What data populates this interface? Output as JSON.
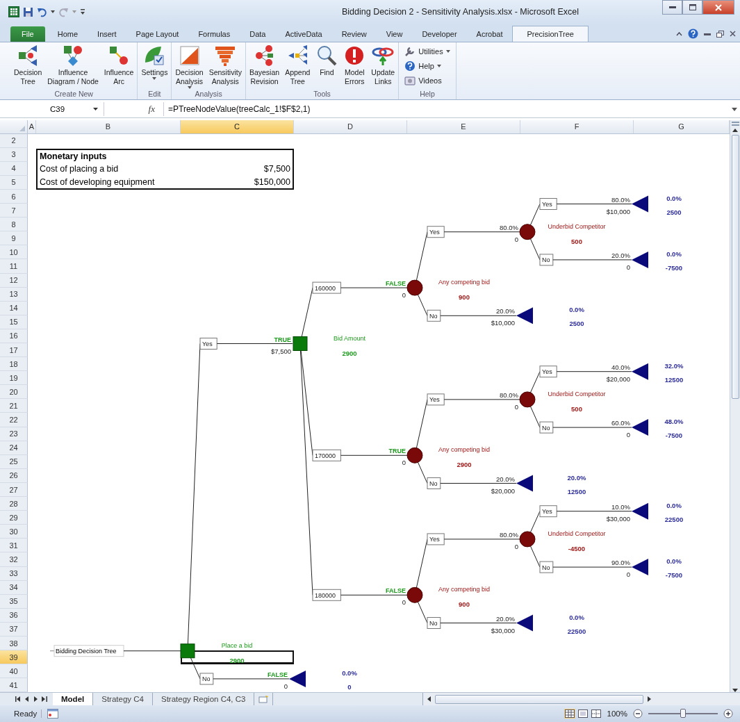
{
  "window": {
    "title": "Bidding Decision 2 - Sensitivity Analysis.xlsx - Microsoft Excel"
  },
  "ribbon_tabs": [
    {
      "label": "File",
      "kind": "file",
      "selected": false
    },
    {
      "label": "Home",
      "kind": "tab",
      "selected": false
    },
    {
      "label": "Insert",
      "kind": "tab",
      "selected": false
    },
    {
      "label": "Page Layout",
      "kind": "tab",
      "selected": false
    },
    {
      "label": "Formulas",
      "kind": "tab",
      "selected": false
    },
    {
      "label": "Data",
      "kind": "tab",
      "selected": false
    },
    {
      "label": "ActiveData",
      "kind": "tab",
      "selected": false
    },
    {
      "label": "Review",
      "kind": "tab",
      "selected": false
    },
    {
      "label": "View",
      "kind": "tab",
      "selected": false
    },
    {
      "label": "Developer",
      "kind": "tab",
      "selected": false
    },
    {
      "label": "Acrobat",
      "kind": "tab",
      "selected": false
    },
    {
      "label": "PrecisionTree",
      "kind": "tab",
      "selected": true
    }
  ],
  "ribbon_groups": [
    {
      "label": "Create New",
      "buttons": [
        {
          "label": "Decision\nTree",
          "kind": "large",
          "has_menu": false
        },
        {
          "label": "Influence\nDiagram / Node",
          "kind": "large",
          "has_menu": false
        },
        {
          "label": "Influence\nArc",
          "kind": "large",
          "has_menu": false
        }
      ]
    },
    {
      "label": "Edit",
      "buttons": [
        {
          "label": "Settings",
          "kind": "large",
          "has_menu": true
        }
      ]
    },
    {
      "label": "Analysis",
      "buttons": [
        {
          "label": "Decision\nAnalysis",
          "kind": "large",
          "has_menu": true
        },
        {
          "label": "Sensitivity\nAnalysis",
          "kind": "large",
          "has_menu": false
        }
      ]
    },
    {
      "label": "Tools",
      "buttons": [
        {
          "label": "Bayesian\nRevision",
          "kind": "large",
          "has_menu": false
        },
        {
          "label": "Append\nTree",
          "kind": "large",
          "has_menu": false
        },
        {
          "label": "Find",
          "kind": "large",
          "has_menu": false
        },
        {
          "label": "Model\nErrors",
          "kind": "large",
          "has_menu": false
        },
        {
          "label": "Update\nLinks",
          "kind": "large",
          "has_menu": false
        }
      ]
    },
    {
      "label": "Help",
      "buttons": [
        {
          "label": "Utilities",
          "kind": "small",
          "has_menu": true
        },
        {
          "label": "Help",
          "kind": "small",
          "has_menu": true
        },
        {
          "label": "Videos",
          "kind": "small",
          "has_menu": false
        }
      ]
    }
  ],
  "formula_bar": {
    "name_box": "C39",
    "function_label": "fx",
    "formula": "=PTreeNodeValue(treeCalc_1!$F$2,1)"
  },
  "columns": [
    {
      "label": "A",
      "selected": false
    },
    {
      "label": "B",
      "selected": false
    },
    {
      "label": "C",
      "selected": true
    },
    {
      "label": "D",
      "selected": false
    },
    {
      "label": "E",
      "selected": false
    },
    {
      "label": "F",
      "selected": false
    },
    {
      "label": "G",
      "selected": false
    }
  ],
  "rows": [
    {
      "label": "2",
      "selected": false
    },
    {
      "label": "3",
      "selected": false
    },
    {
      "label": "4",
      "selected": false
    },
    {
      "label": "5",
      "selected": false
    },
    {
      "label": "6",
      "selected": false
    },
    {
      "label": "7",
      "selected": false
    },
    {
      "label": "8",
      "selected": false
    },
    {
      "label": "9",
      "selected": false
    },
    {
      "label": "10",
      "selected": false
    },
    {
      "label": "11",
      "selected": false
    },
    {
      "label": "12",
      "selected": false
    },
    {
      "label": "13",
      "selected": false
    },
    {
      "label": "14",
      "selected": false
    },
    {
      "label": "15",
      "selected": false
    },
    {
      "label": "16",
      "selected": false
    },
    {
      "label": "17",
      "selected": false
    },
    {
      "label": "18",
      "selected": false
    },
    {
      "label": "19",
      "selected": false
    },
    {
      "label": "20",
      "selected": false
    },
    {
      "label": "21",
      "selected": false
    },
    {
      "label": "22",
      "selected": false
    },
    {
      "label": "23",
      "selected": false
    },
    {
      "label": "24",
      "selected": false
    },
    {
      "label": "25",
      "selected": false
    },
    {
      "label": "26",
      "selected": false
    },
    {
      "label": "27",
      "selected": false
    },
    {
      "label": "28",
      "selected": false
    },
    {
      "label": "29",
      "selected": false
    },
    {
      "label": "30",
      "selected": false
    },
    {
      "label": "31",
      "selected": false
    },
    {
      "label": "32",
      "selected": false
    },
    {
      "label": "33",
      "selected": false
    },
    {
      "label": "34",
      "selected": false
    },
    {
      "label": "35",
      "selected": false
    },
    {
      "label": "36",
      "selected": false
    },
    {
      "label": "37",
      "selected": false
    },
    {
      "label": "38",
      "selected": false
    },
    {
      "label": "39",
      "selected": true
    },
    {
      "label": "40",
      "selected": false
    },
    {
      "label": "41",
      "selected": false
    }
  ],
  "inputs_table": {
    "title": "Monetary inputs",
    "rows": [
      {
        "label": "Cost of placing a bid",
        "value": "$7,500"
      },
      {
        "label": "Cost of developing equipment",
        "value": "$150,000"
      }
    ]
  },
  "tree": {
    "label": "Bidding Decision Tree",
    "node": {
      "kind": "decision",
      "name": "Place a bid",
      "value": "2900",
      "branches": [
        {
          "label": "Yes",
          "above": "TRUE",
          "below": "$7,500",
          "node": {
            "kind": "decision",
            "name": "Bid Amount",
            "value": "2900",
            "branches": [
              {
                "label": "160000",
                "above": "FALSE",
                "below": "0",
                "node": {
                  "kind": "chance",
                  "name": "Any competing bid",
                  "value": "900",
                  "branches": [
                    {
                      "label": "Yes",
                      "above": "80.0%",
                      "below": "0",
                      "node": {
                        "kind": "chance",
                        "name": "Underbid Competitor",
                        "value": "500",
                        "branches": [
                          {
                            "label": "Yes",
                            "above": "80.0%",
                            "below": "$10,000",
                            "node": {
                              "kind": "end",
                              "probability": "0.0%",
                              "value": "2500"
                            }
                          },
                          {
                            "label": "No",
                            "above": "20.0%",
                            "below": "0",
                            "node": {
                              "kind": "end",
                              "probability": "0.0%",
                              "value": "-7500"
                            }
                          }
                        ]
                      }
                    },
                    {
                      "label": "No",
                      "above": "20.0%",
                      "below": "$10,000",
                      "node": {
                        "kind": "end",
                        "probability": "0.0%",
                        "value": "2500"
                      }
                    }
                  ]
                }
              },
              {
                "label": "170000",
                "above": "TRUE",
                "below": "0",
                "node": {
                  "kind": "chance",
                  "name": "Any competing bid",
                  "value": "2900",
                  "branches": [
                    {
                      "label": "Yes",
                      "above": "80.0%",
                      "below": "0",
                      "node": {
                        "kind": "chance",
                        "name": "Underbid Competitor",
                        "value": "500",
                        "branches": [
                          {
                            "label": "Yes",
                            "above": "40.0%",
                            "below": "$20,000",
                            "node": {
                              "kind": "end",
                              "probability": "32.0%",
                              "value": "12500"
                            }
                          },
                          {
                            "label": "No",
                            "above": "60.0%",
                            "below": "0",
                            "node": {
                              "kind": "end",
                              "probability": "48.0%",
                              "value": "-7500"
                            }
                          }
                        ]
                      }
                    },
                    {
                      "label": "No",
                      "above": "20.0%",
                      "below": "$20,000",
                      "node": {
                        "kind": "end",
                        "probability": "20.0%",
                        "value": "12500"
                      }
                    }
                  ]
                }
              },
              {
                "label": "180000",
                "above": "FALSE",
                "below": "0",
                "node": {
                  "kind": "chance",
                  "name": "Any competing bid",
                  "value": "900",
                  "branches": [
                    {
                      "label": "Yes",
                      "above": "80.0%",
                      "below": "0",
                      "node": {
                        "kind": "chance",
                        "name": "Underbid Competitor",
                        "value": "-4500",
                        "branches": [
                          {
                            "label": "Yes",
                            "above": "10.0%",
                            "below": "$30,000",
                            "node": {
                              "kind": "end",
                              "probability": "0.0%",
                              "value": "22500"
                            }
                          },
                          {
                            "label": "No",
                            "above": "90.0%",
                            "below": "0",
                            "node": {
                              "kind": "end",
                              "probability": "0.0%",
                              "value": "-7500"
                            }
                          }
                        ]
                      }
                    },
                    {
                      "label": "No",
                      "above": "20.0%",
                      "below": "$30,000",
                      "node": {
                        "kind": "end",
                        "probability": "0.0%",
                        "value": "22500"
                      }
                    }
                  ]
                }
              }
            ]
          }
        },
        {
          "label": "No",
          "above": "FALSE",
          "below": "0",
          "node": {
            "kind": "end",
            "probability": "0.0%",
            "value": "0"
          }
        }
      ]
    }
  },
  "sheet_tabs": [
    {
      "label": "Model",
      "selected": true
    },
    {
      "label": "Strategy C4",
      "selected": false
    },
    {
      "label": "Strategy Region C4, C3",
      "selected": false
    }
  ],
  "status_bar": {
    "status": "Ready",
    "zoom": {
      "reading": "100%",
      "level": 0.5
    }
  }
}
